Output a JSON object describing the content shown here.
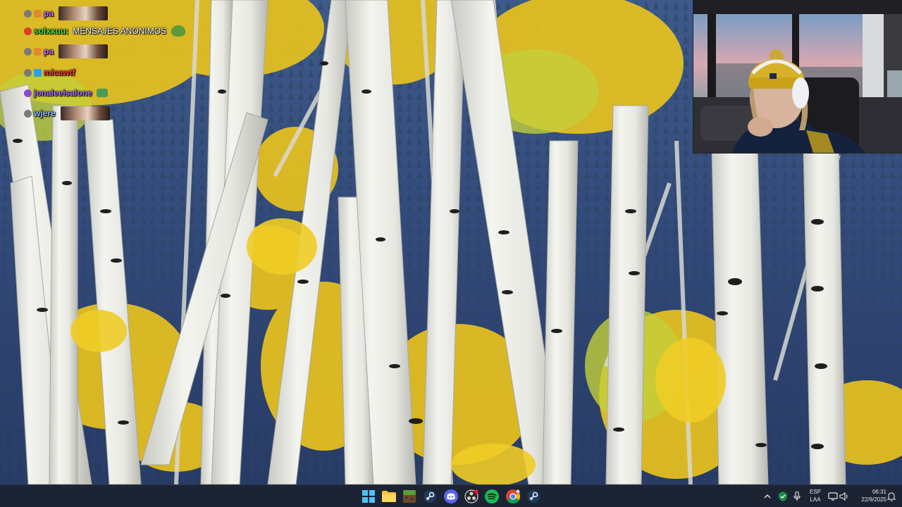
{
  "chat": {
    "messages": [
      {
        "user": "pa",
        "user_color": "#c06cff",
        "text": "",
        "emote": "face-emote"
      },
      {
        "user": "solxxuu:",
        "user_color": "#44dd44",
        "text": "MENSAJES ANONIMOS",
        "emote": "pepe-frog-emote"
      },
      {
        "user": "pa",
        "user_color": "#c06cff",
        "text": "",
        "emote": "face-emote"
      },
      {
        "user": "micawtf",
        "user_color": "#ff3b3b",
        "text": "",
        "emote": ""
      },
      {
        "user": "jonaleeisalone",
        "user_color": "#a970ff",
        "text": "",
        "emote": "small-emote"
      },
      {
        "user": "wjere",
        "user_color": "#8fb8ff",
        "text": "",
        "emote": "face-emote"
      }
    ]
  },
  "taskbar": {
    "apps": [
      {
        "name": "windows-start",
        "icon": "windows-logo"
      },
      {
        "name": "file-explorer",
        "icon": "folder-icon"
      },
      {
        "name": "minecraft",
        "icon": "minecraft-icon"
      },
      {
        "name": "steam",
        "icon": "steam-icon"
      },
      {
        "name": "discord",
        "icon": "discord-icon"
      },
      {
        "name": "obs",
        "icon": "obs-icon"
      },
      {
        "name": "spotify",
        "icon": "spotify-icon"
      },
      {
        "name": "chrome",
        "icon": "chrome-icon"
      },
      {
        "name": "steam-2",
        "icon": "steam-icon"
      }
    ],
    "tray": {
      "language_line1": "ESP",
      "language_line2": "LAA",
      "time": "06:31",
      "date": "22/9/2025"
    }
  },
  "colors": {
    "taskbar_bg": "#1c2433",
    "accent_spotify": "#1db954",
    "accent_discord": "#5865f2"
  }
}
